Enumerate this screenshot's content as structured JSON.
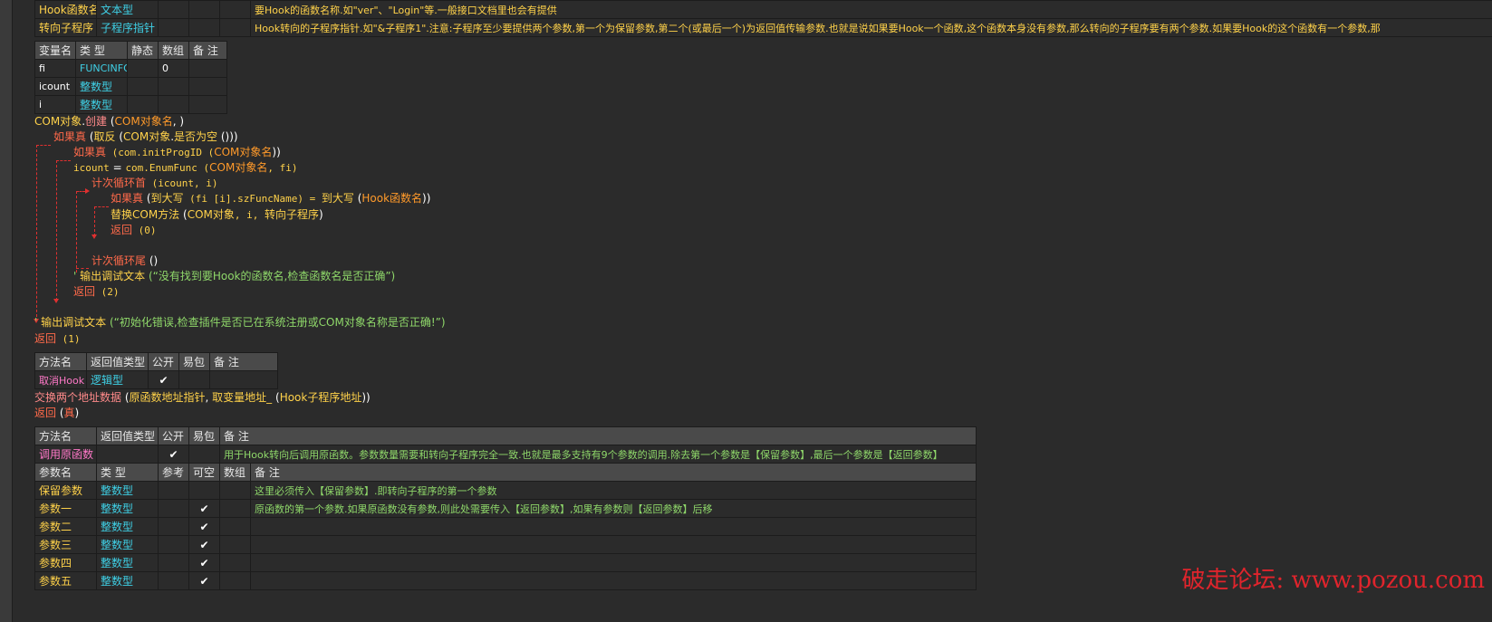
{
  "top_table": {
    "rows": [
      {
        "name": "Hook函数名",
        "type": "文本型",
        "note": "要Hook的函数名称.如\"ver\"、\"Login\"等.一般接口文档里也会有提供"
      },
      {
        "name": "转向子程序",
        "type": "子程序指针",
        "note": "Hook转向的子程序指针.如\"&子程序1\".注意:子程序至少要提供两个参数,第一个为保留参数,第二个(或最后一个)为返回值传输参数.也就是说如果要Hook一个函数,这个函数本身没有参数,那么转向的子程序要有两个参数.如果要Hook的这个函数有一个参数,那"
      }
    ]
  },
  "var_table": {
    "headers": [
      "变量名",
      "类 型",
      "静态",
      "数组",
      "备 注"
    ],
    "rows": [
      {
        "name": "fi",
        "type": "FUNCINFO",
        "static": "",
        "array": "0",
        "note": ""
      },
      {
        "name": "icount",
        "type": "整数型",
        "static": "",
        "array": "",
        "note": ""
      },
      {
        "name": "i",
        "type": "整数型",
        "static": "",
        "array": "",
        "note": ""
      }
    ]
  },
  "code": {
    "l1_obj": "COM对象",
    "l1_dot": ".",
    "l1_fn": "创建",
    "l1_args_open": " (",
    "l1_arg": "COM对象名",
    "l1_args_close": ", )",
    "l2_kw": "如果真",
    "l2_open": " (",
    "l2_fn": "取反",
    "l2_mid": " (",
    "l2_obj": "COM对象",
    "l2_dot": ".",
    "l2_m": "是否为空",
    "l2_close": " ()))",
    "l3_kw": "如果真",
    "l3_a": " (com.initProgID (",
    "l3_arg": "COM对象名",
    "l3_b": "))",
    "l4_var": "icount",
    "l4_eq": " = ",
    "l4_call": "com.EnumFunc (",
    "l4_arg": "COM对象名",
    "l4_rest": ", fi)",
    "l5_kw": "计次循环首",
    "l5_rest": " (icount, i)",
    "l6_kw": "如果真",
    "l6_a": " (",
    "l6_fn1": "到大写",
    "l6_b": " (fi [i].szFuncName) = ",
    "l6_fn2": "到大写",
    "l6_c": " (",
    "l6_arg": "Hook函数名",
    "l6_d": "))",
    "l7_fn": "替换COM方法",
    "l7_a": " (",
    "l7_arg1": "COM对象",
    "l7_b": ", i, ",
    "l7_arg2": "转向子程序",
    "l7_c": ")",
    "l8_kw": "返回",
    "l8_rest": " (0)",
    "l9_kw": "计次循环尾",
    "l9_rest": " ()",
    "l10_q": "'",
    "l10_fn": " 输出调试文本",
    "l10_str": " (“没有找到要Hook的函数名,检查函数名是否正确”)",
    "l11_kw": "返回",
    "l11_rest": " (2)",
    "l12_q": "'",
    "l12_fn": " 输出调试文本",
    "l12_str": " (“初始化错误,检查插件是否已在系统注册或COM对象名称是否正确!”)",
    "l13_kw": "返回",
    "l13_rest": " (1)"
  },
  "method1": {
    "headers": [
      "方法名",
      "返回值类型",
      "公开",
      "易包",
      "备 注"
    ],
    "name": "取消Hook",
    "ret": "逻辑型",
    "public": "✔",
    "pkg": "",
    "note": ""
  },
  "code2": {
    "l1_fn": "交换两个地址数据",
    "l1_a": " (",
    "l1_arg1": "原函数地址指针",
    "l1_b": ", ",
    "l1_fn2": "取变量地址_",
    "l1_c": " (",
    "l1_arg2": "Hook子程序地址",
    "l1_d": "))",
    "l2_kw": "返回",
    "l2_a": " (",
    "l2_val": "真",
    "l2_b": ")"
  },
  "method2": {
    "headers": [
      "方法名",
      "返回值类型",
      "公开",
      "易包",
      "备 注"
    ],
    "name": "调用原函数",
    "ret": "",
    "public": "✔",
    "pkg": "",
    "note": "用于Hook转向后调用原函数。参数数量需要和转向子程序完全一致.也就是最多支持有9个参数的调用.除去第一个参数是【保留参数】,最后一个参数是【返回参数】",
    "param_headers": [
      "参数名",
      "类 型",
      "参考",
      "可空",
      "数组",
      "备 注"
    ],
    "params": [
      {
        "name": "保留参数",
        "type": "整数型",
        "ref": "",
        "nullable": "",
        "array": "",
        "note": "这里必须传入【保留参数】.即转向子程序的第一个参数"
      },
      {
        "name": "参数一",
        "type": "整数型",
        "ref": "",
        "nullable": "✔",
        "array": "",
        "note": "原函数的第一个参数.如果原函数没有参数,则此处需要传入【返回参数】,如果有参数则【返回参数】后移"
      },
      {
        "name": "参数二",
        "type": "整数型",
        "ref": "",
        "nullable": "✔",
        "array": "",
        "note": ""
      },
      {
        "name": "参数三",
        "type": "整数型",
        "ref": "",
        "nullable": "✔",
        "array": "",
        "note": ""
      },
      {
        "name": "参数四",
        "type": "整数型",
        "ref": "",
        "nullable": "✔",
        "array": "",
        "note": ""
      },
      {
        "name": "参数五",
        "type": "整数型",
        "ref": "",
        "nullable": "✔",
        "array": "",
        "note": ""
      }
    ]
  },
  "watermark": "破走论坛: www.pozou.com"
}
